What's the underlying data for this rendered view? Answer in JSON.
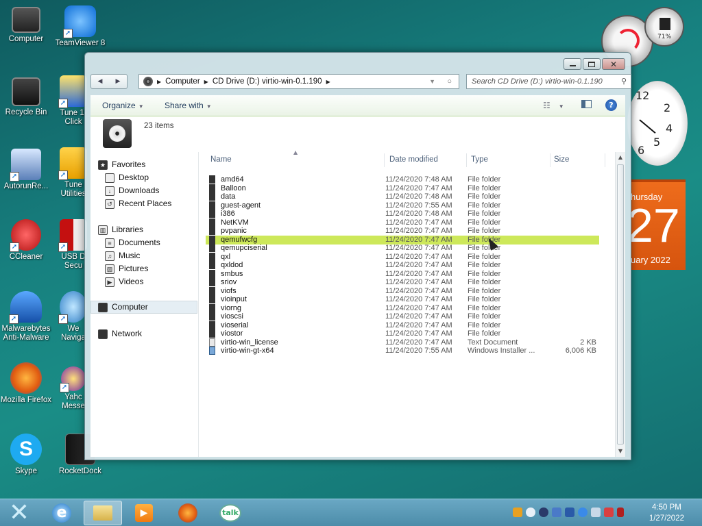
{
  "desktop": {
    "icons": [
      {
        "label": "Computer"
      },
      {
        "label": "TeamViewer 8"
      },
      {
        "label": "Recycle Bin"
      },
      {
        "label": "Tune 1-Click"
      },
      {
        "label": "AutorunRe..."
      },
      {
        "label": "Tune Utilities"
      },
      {
        "label": "CCleaner"
      },
      {
        "label": "USB D Secu"
      },
      {
        "label": "Malwarebytes Anti-Malware"
      },
      {
        "label": "We Naviga"
      },
      {
        "label": "Mozilla Firefox"
      },
      {
        "label": "Yahc Messe"
      },
      {
        "label": "Skype"
      },
      {
        "label": "RocketDock"
      }
    ]
  },
  "gadgets": {
    "meter_percent": "71%",
    "calendar": {
      "weekday": "hursday",
      "day": "27",
      "month_year": "uary 2022"
    },
    "clock_numbers": [
      "12",
      "2",
      "4",
      "5",
      "6"
    ]
  },
  "explorer": {
    "address": {
      "root": "Computer",
      "drive": "CD Drive (D:) virtio-win-0.1.190"
    },
    "search_placeholder": "Search CD Drive (D:) virtio-win-0.1.190",
    "toolbar": {
      "organize": "Organize",
      "share_with": "Share with"
    },
    "items_count": "23 items",
    "nav": {
      "favorites": "Favorites",
      "desktop": "Desktop",
      "downloads": "Downloads",
      "recent_places": "Recent Places",
      "libraries": "Libraries",
      "documents": "Documents",
      "music": "Music",
      "pictures": "Pictures",
      "videos": "Videos",
      "computer": "Computer",
      "network": "Network"
    },
    "columns": {
      "name": "Name",
      "date": "Date modified",
      "type": "Type",
      "size": "Size"
    },
    "files": [
      {
        "name": "amd64",
        "date": "11/24/2020 7:48 AM",
        "type": "File folder",
        "size": ""
      },
      {
        "name": "Balloon",
        "date": "11/24/2020 7:47 AM",
        "type": "File folder",
        "size": ""
      },
      {
        "name": "data",
        "date": "11/24/2020 7:48 AM",
        "type": "File folder",
        "size": ""
      },
      {
        "name": "guest-agent",
        "date": "11/24/2020 7:55 AM",
        "type": "File folder",
        "size": ""
      },
      {
        "name": "i386",
        "date": "11/24/2020 7:48 AM",
        "type": "File folder",
        "size": ""
      },
      {
        "name": "NetKVM",
        "date": "11/24/2020 7:47 AM",
        "type": "File folder",
        "size": ""
      },
      {
        "name": "pvpanic",
        "date": "11/24/2020 7:47 AM",
        "type": "File folder",
        "size": ""
      },
      {
        "name": "qemufwcfg",
        "date": "11/24/2020 7:47 AM",
        "type": "File folder",
        "size": ""
      },
      {
        "name": "qemupciserial",
        "date": "11/24/2020 7:47 AM",
        "type": "File folder",
        "size": ""
      },
      {
        "name": "qxl",
        "date": "11/24/2020 7:47 AM",
        "type": "File folder",
        "size": ""
      },
      {
        "name": "qxldod",
        "date": "11/24/2020 7:47 AM",
        "type": "File folder",
        "size": ""
      },
      {
        "name": "smbus",
        "date": "11/24/2020 7:47 AM",
        "type": "File folder",
        "size": ""
      },
      {
        "name": "sriov",
        "date": "11/24/2020 7:47 AM",
        "type": "File folder",
        "size": ""
      },
      {
        "name": "viofs",
        "date": "11/24/2020 7:47 AM",
        "type": "File folder",
        "size": ""
      },
      {
        "name": "vioinput",
        "date": "11/24/2020 7:47 AM",
        "type": "File folder",
        "size": ""
      },
      {
        "name": "viorng",
        "date": "11/24/2020 7:47 AM",
        "type": "File folder",
        "size": ""
      },
      {
        "name": "vioscsi",
        "date": "11/24/2020 7:47 AM",
        "type": "File folder",
        "size": ""
      },
      {
        "name": "vioserial",
        "date": "11/24/2020 7:47 AM",
        "type": "File folder",
        "size": ""
      },
      {
        "name": "viostor",
        "date": "11/24/2020 7:47 AM",
        "type": "File folder",
        "size": ""
      },
      {
        "name": "virtio-win_license",
        "date": "11/24/2020 7:47 AM",
        "type": "Text Document",
        "size": "2 KB"
      },
      {
        "name": "virtio-win-gt-x64",
        "date": "11/24/2020 7:55 AM",
        "type": "Windows Installer ...",
        "size": "6,006 KB"
      }
    ]
  },
  "taskbar": {
    "time": "4:50 PM",
    "date": "1/27/2022"
  }
}
